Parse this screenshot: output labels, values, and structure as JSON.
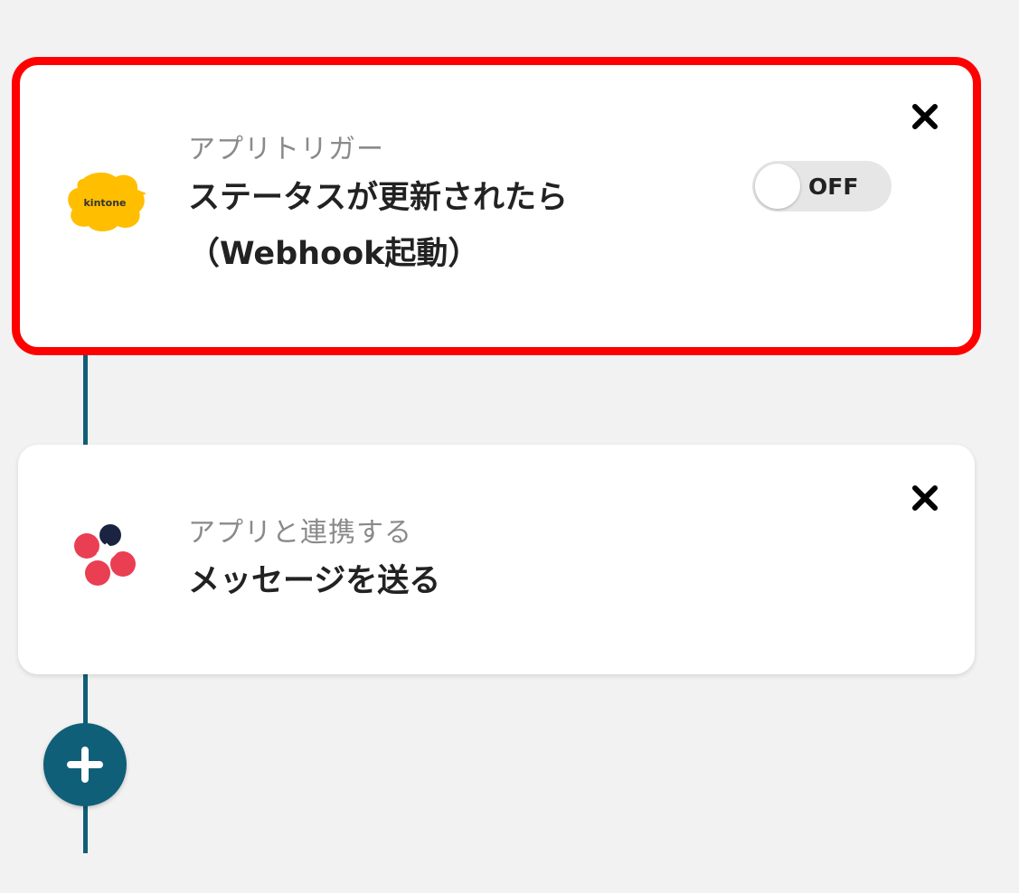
{
  "flow": {
    "trigger": {
      "subtitle": "アプリトリガー",
      "title": "ステータスが更新されたら（Webhook起動）",
      "app_icon": "kintone-logo",
      "app_logo_text": "kintone",
      "toggle_label": "OFF",
      "toggle_state": "off",
      "close_icon": "close-icon"
    },
    "action": {
      "subtitle": "アプリと連携する",
      "title": "メッセージを送る",
      "app_icon": "chatwork-logo",
      "close_icon": "close-icon"
    },
    "add_step": {
      "icon": "plus-icon"
    }
  },
  "colors": {
    "background": "#f2f2f2",
    "connector": "#0f5f78",
    "highlight": "#ff0000",
    "kintone_yellow": "#ffbe00",
    "chatwork_red": "#ea3e52",
    "chatwork_navy": "#1a2340"
  }
}
